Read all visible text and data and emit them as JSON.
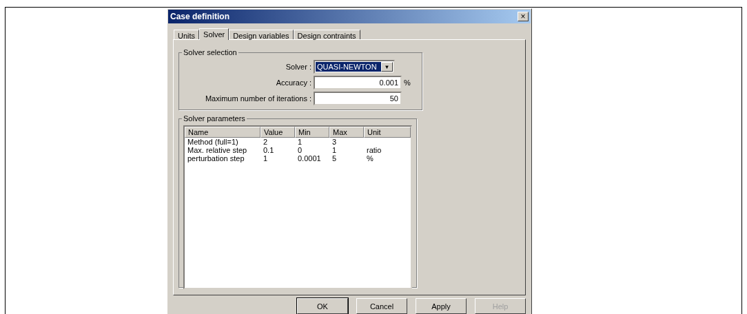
{
  "window": {
    "title": "Case definition",
    "close": "×"
  },
  "tabs": [
    {
      "label": "Units",
      "selected": false
    },
    {
      "label": "Solver",
      "selected": true
    },
    {
      "label": "Design variables",
      "selected": false
    },
    {
      "label": "Design contraints",
      "selected": false
    }
  ],
  "solver_selection": {
    "title": "Solver selection",
    "solver": {
      "label": "Solver :",
      "value": "QUASI-NEWTON",
      "arrow": "▼"
    },
    "accuracy": {
      "label": "Accuracy :",
      "value": "0.001",
      "unit": "%"
    },
    "iterations": {
      "label": "Maximum number of iterations :",
      "value": "50"
    }
  },
  "solver_parameters": {
    "title": "Solver parameters",
    "columns": [
      "Name",
      "Value",
      "Min",
      "Max",
      "Unit"
    ],
    "rows": [
      [
        "Method (full=1)",
        "2",
        "1",
        "3",
        ""
      ],
      [
        "Max. relative step",
        "0.1",
        "0",
        "1",
        "ratio"
      ],
      [
        "perturbation step",
        "1",
        "0.0001",
        "5",
        "%"
      ]
    ]
  },
  "buttons": [
    {
      "label": "OK",
      "disabled": false,
      "default": true
    },
    {
      "label": "Cancel",
      "disabled": false,
      "default": false
    },
    {
      "label": "Apply",
      "disabled": false,
      "default": false
    },
    {
      "label": "Help",
      "disabled": true,
      "default": false
    }
  ]
}
